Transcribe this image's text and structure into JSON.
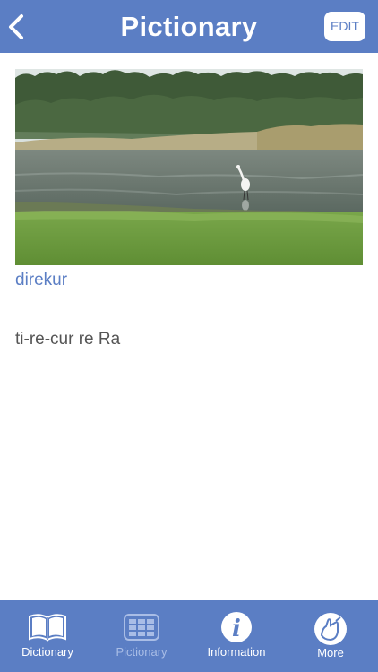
{
  "header": {
    "title": "Pictionary",
    "back_icon": "chevron-left-icon",
    "edit_label": "EDIT"
  },
  "entry": {
    "photo": "wetland-egret-photo",
    "word": "direkur",
    "pronunciation": "ti-re-cur re Ra"
  },
  "tabs": [
    {
      "label": "Dictionary",
      "icon": "open-book-icon",
      "active": true
    },
    {
      "label": "Pictionary",
      "icon": "grid-icon",
      "active": false
    },
    {
      "label": "Information",
      "icon": "info-icon",
      "active": true
    },
    {
      "label": "More",
      "icon": "more-icon",
      "active": true
    }
  ],
  "colors": {
    "accent": "#5b7ec4",
    "tab_inactive": "#a9bde6",
    "text": "#555555"
  }
}
